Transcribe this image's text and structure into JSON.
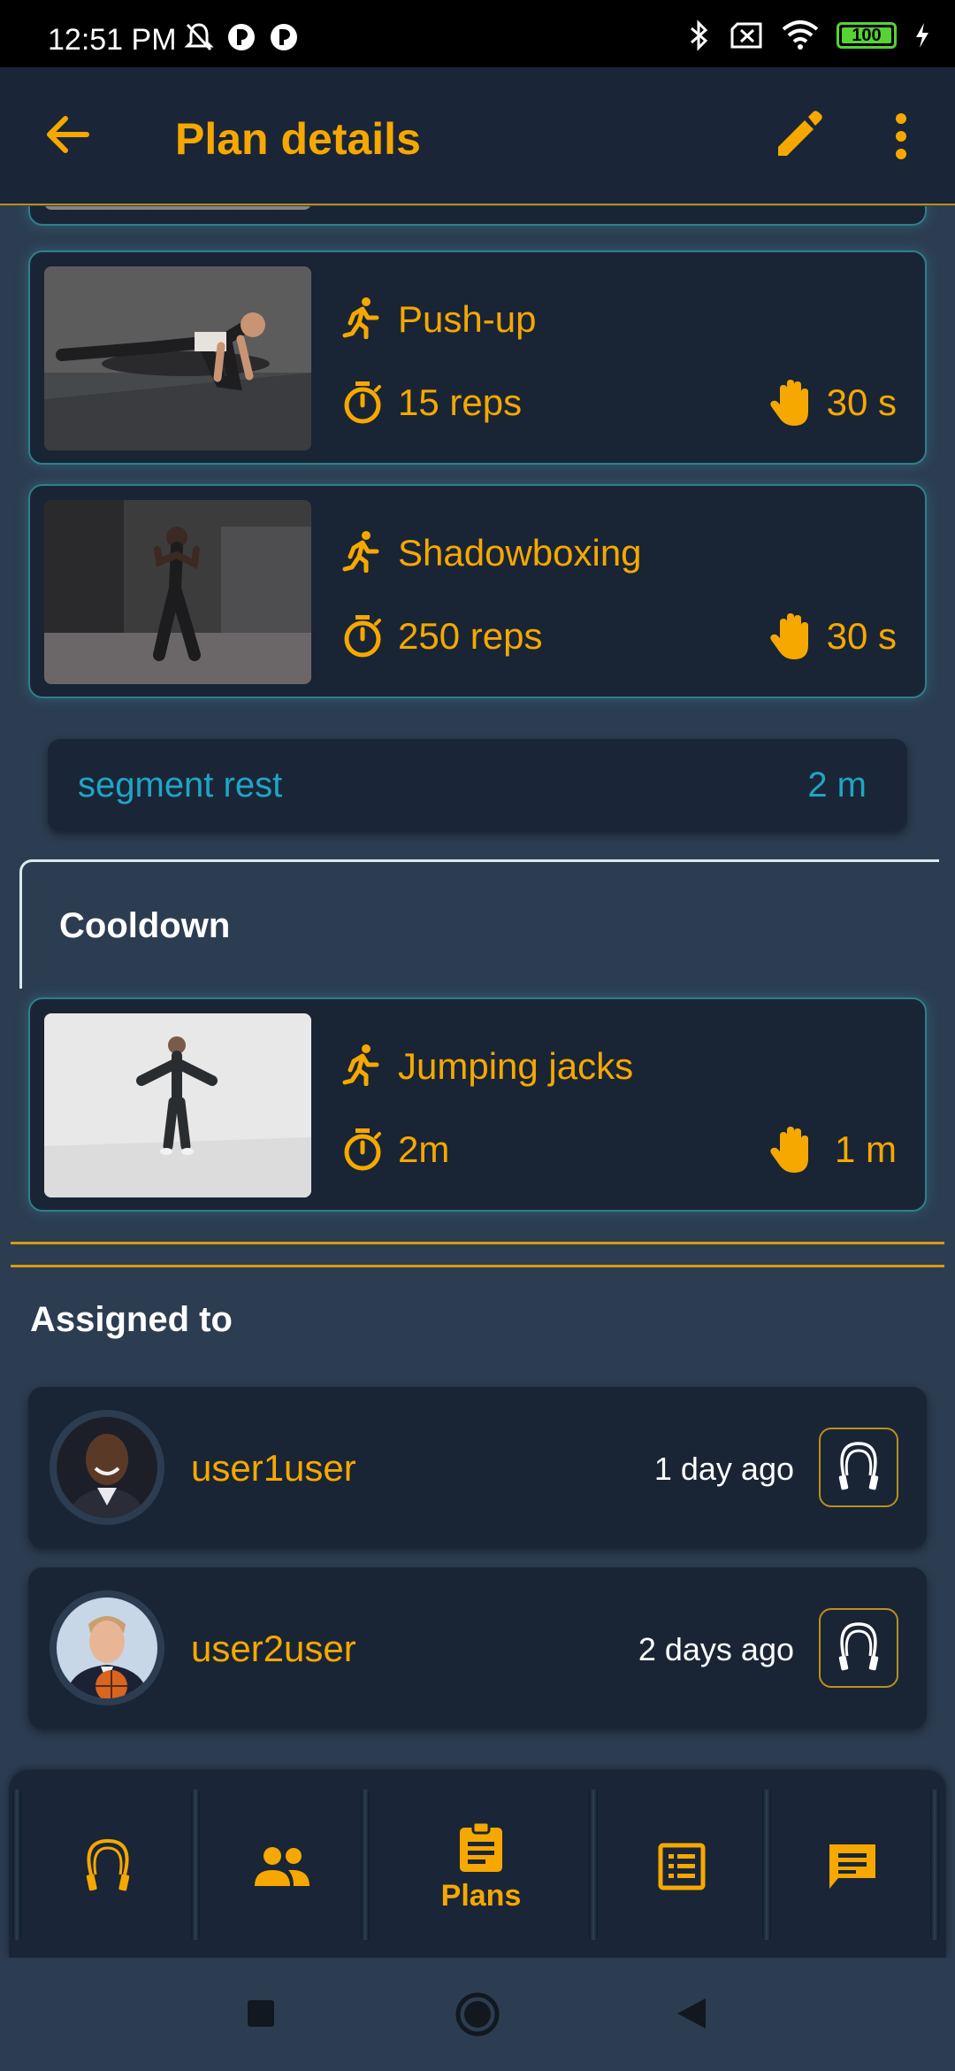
{
  "status_bar": {
    "time": "12:51 PM",
    "battery": "100"
  },
  "app_bar": {
    "title": "Plan details"
  },
  "exercises": [
    {
      "name": "Push-up",
      "amount": "15 reps",
      "rest": "30 s"
    },
    {
      "name": "Shadowboxing",
      "amount": "250 reps",
      "rest": "30 s"
    }
  ],
  "segment_rest": {
    "label": "segment rest",
    "value": "2 m"
  },
  "cooldown": {
    "title": "Cooldown",
    "exercises": [
      {
        "name": "Jumping jacks",
        "amount": "2m",
        "rest": "1 m"
      }
    ]
  },
  "assigned": {
    "title": "Assigned to",
    "users": [
      {
        "name": "user1user",
        "when": "1 day ago"
      },
      {
        "name": "user2user",
        "when": "2 days ago"
      }
    ]
  },
  "bottom_nav": {
    "active_label": "Plans"
  },
  "colors": {
    "accent": "#f6a800",
    "background": "#2c3d51",
    "card": "#192535",
    "rest_text": "#1fa5c6"
  }
}
